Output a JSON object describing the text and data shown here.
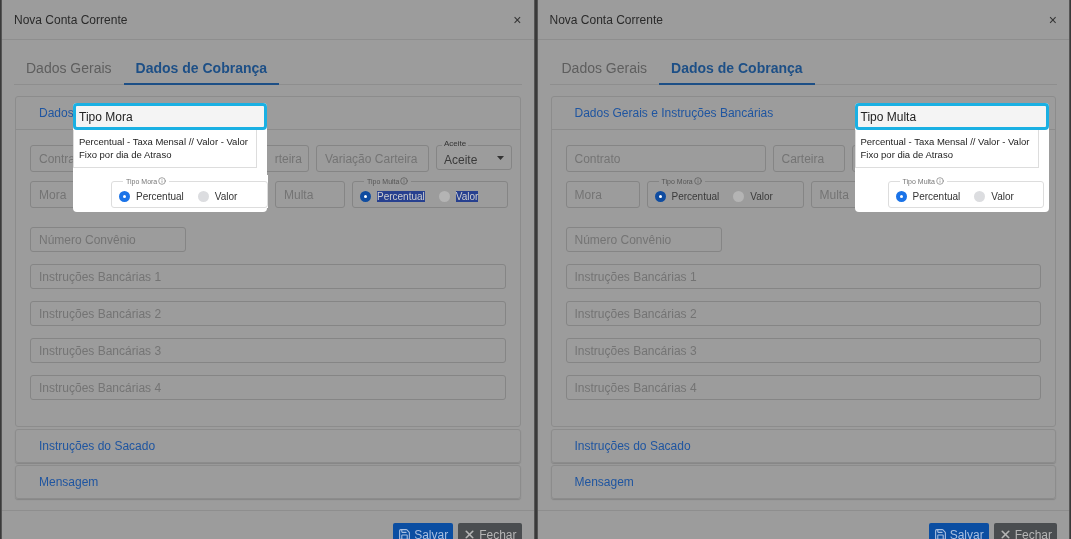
{
  "panels": [
    {
      "title": "Nova Conta Corrente",
      "close": "×",
      "tabs": [
        {
          "label": "Dados Gerais",
          "selected": false
        },
        {
          "label": "Dados de Cobrança",
          "selected": true
        }
      ],
      "section_title": "Dados",
      "row1": [
        {
          "kind": "input",
          "placeholder": "Contra"
        },
        {
          "kind": "input",
          "placeholder": "rteira",
          "cut_start": true
        },
        {
          "kind": "input",
          "placeholder": "Variação Carteira"
        },
        {
          "kind": "select",
          "label": "Aceite",
          "value": "Aceite"
        }
      ],
      "row2": [
        {
          "kind": "input",
          "placeholder": "Mora"
        },
        {
          "kind": "radio_group",
          "label": "Tipo Mora",
          "highlighted": true,
          "options": [
            {
              "label": "Percentual",
              "selected": true,
              "text_selected": false
            },
            {
              "label": "Valor",
              "selected": false,
              "text_selected": false
            }
          ]
        },
        {
          "kind": "input",
          "placeholder": "Multa"
        },
        {
          "kind": "radio_group",
          "label": "Tipo Multa",
          "highlighted": false,
          "options": [
            {
              "label": "Percentual",
              "selected": true,
              "text_selected": true
            },
            {
              "label": "Valor",
              "selected": false,
              "text_selected": true
            }
          ]
        }
      ],
      "fields": [
        {
          "placeholder": "Número Convênio",
          "wide": false
        },
        {
          "placeholder": "Instruções Bancárias 1",
          "wide": true
        },
        {
          "placeholder": "Instruções Bancárias 2",
          "wide": true
        },
        {
          "placeholder": "Instruções Bancárias 3",
          "wide": true
        },
        {
          "placeholder": "Instruções Bancárias 4",
          "wide": true
        }
      ],
      "collapsed_sections": [
        "Instruções do Sacado",
        "Mensagem"
      ],
      "tooltip": {
        "title": "Tipo Mora",
        "text": "Percentual - Taxa Mensal // Valor - Valor Fixo por dia de Atraso"
      },
      "buttons": [
        {
          "kind": "save",
          "label": "Salvar"
        },
        {
          "kind": "close",
          "label": "Fechar"
        }
      ]
    },
    {
      "title": "Nova Conta Corrente",
      "close": "×",
      "tabs": [
        {
          "label": "Dados Gerais",
          "selected": false
        },
        {
          "label": "Dados de Cobrança",
          "selected": true
        }
      ],
      "section_title": "Dados Gerais e Instruções Bancárias",
      "row1": [
        {
          "kind": "input",
          "placeholder": "Contrato"
        },
        {
          "kind": "input",
          "placeholder": "Carteira"
        },
        {
          "kind": "input"
        }
      ],
      "row2": [
        {
          "kind": "input",
          "placeholder": "Mora"
        },
        {
          "kind": "radio_group",
          "label": "Tipo Mora",
          "highlighted": false,
          "options": [
            {
              "label": "Percentual",
              "selected": true,
              "text_selected": false
            },
            {
              "label": "Valor",
              "selected": false,
              "text_selected": false
            }
          ]
        },
        {
          "kind": "input",
          "placeholder": "Multa"
        },
        {
          "kind": "radio_group",
          "label": "Tipo Multa",
          "highlighted": true,
          "options": [
            {
              "label": "Percentual",
              "selected": true,
              "text_selected": false
            },
            {
              "label": "Valor",
              "selected": false,
              "text_selected": false
            }
          ]
        }
      ],
      "fields": [
        {
          "placeholder": "Número Convênio",
          "wide": false
        },
        {
          "placeholder": "Instruções Bancárias 1",
          "wide": true
        },
        {
          "placeholder": "Instruções Bancárias 2",
          "wide": true
        },
        {
          "placeholder": "Instruções Bancárias 3",
          "wide": true
        },
        {
          "placeholder": "Instruções Bancárias 4",
          "wide": true
        }
      ],
      "collapsed_sections": [
        "Instruções do Sacado",
        "Mensagem"
      ],
      "tooltip": {
        "title": "Tipo Multa",
        "text": "Percentual - Taxa Mensal // Valor - Valor Fixo por dia de Atraso"
      },
      "buttons": [
        {
          "kind": "save",
          "label": "Salvar"
        },
        {
          "kind": "close",
          "label": "Fechar"
        }
      ]
    }
  ]
}
